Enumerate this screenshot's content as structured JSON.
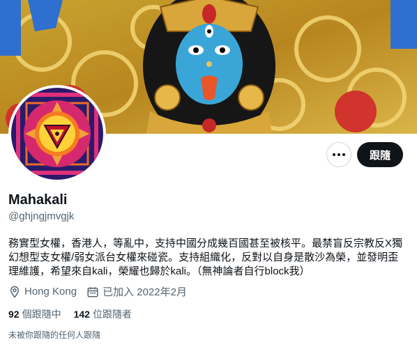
{
  "profile": {
    "display_name": "Mahakali",
    "handle": "@ghjngjmvgjk",
    "bio": "務實型女權，香港人，等亂中，支持中國分成幾百國甚至被核平。最禁盲反宗教反X獨幻想型支女權/弱女派台女權來碰瓷。支持組織化，反對以自身是散沙為榮，並發明歪理維護，希望來自kali，榮耀也歸於kali。（無神論者自行block我）",
    "location": "Hong Kong",
    "joined": "已加入 2022年2月"
  },
  "actions": {
    "follow_label": "跟隨",
    "more_icon": "more-horizontal-icon"
  },
  "stats": {
    "following_count": "92",
    "following_label": "個跟隨中",
    "followers_count": "142",
    "followers_label": "位跟隨者"
  },
  "followers_you_know": "未被你跟隨的任何人跟隨",
  "icons": {
    "location": "location-pin-icon",
    "calendar": "calendar-icon"
  },
  "colors": {
    "text_primary": "#0f1419",
    "text_secondary": "#536471",
    "button_dark": "#0f1419",
    "border": "#cfd9de"
  }
}
